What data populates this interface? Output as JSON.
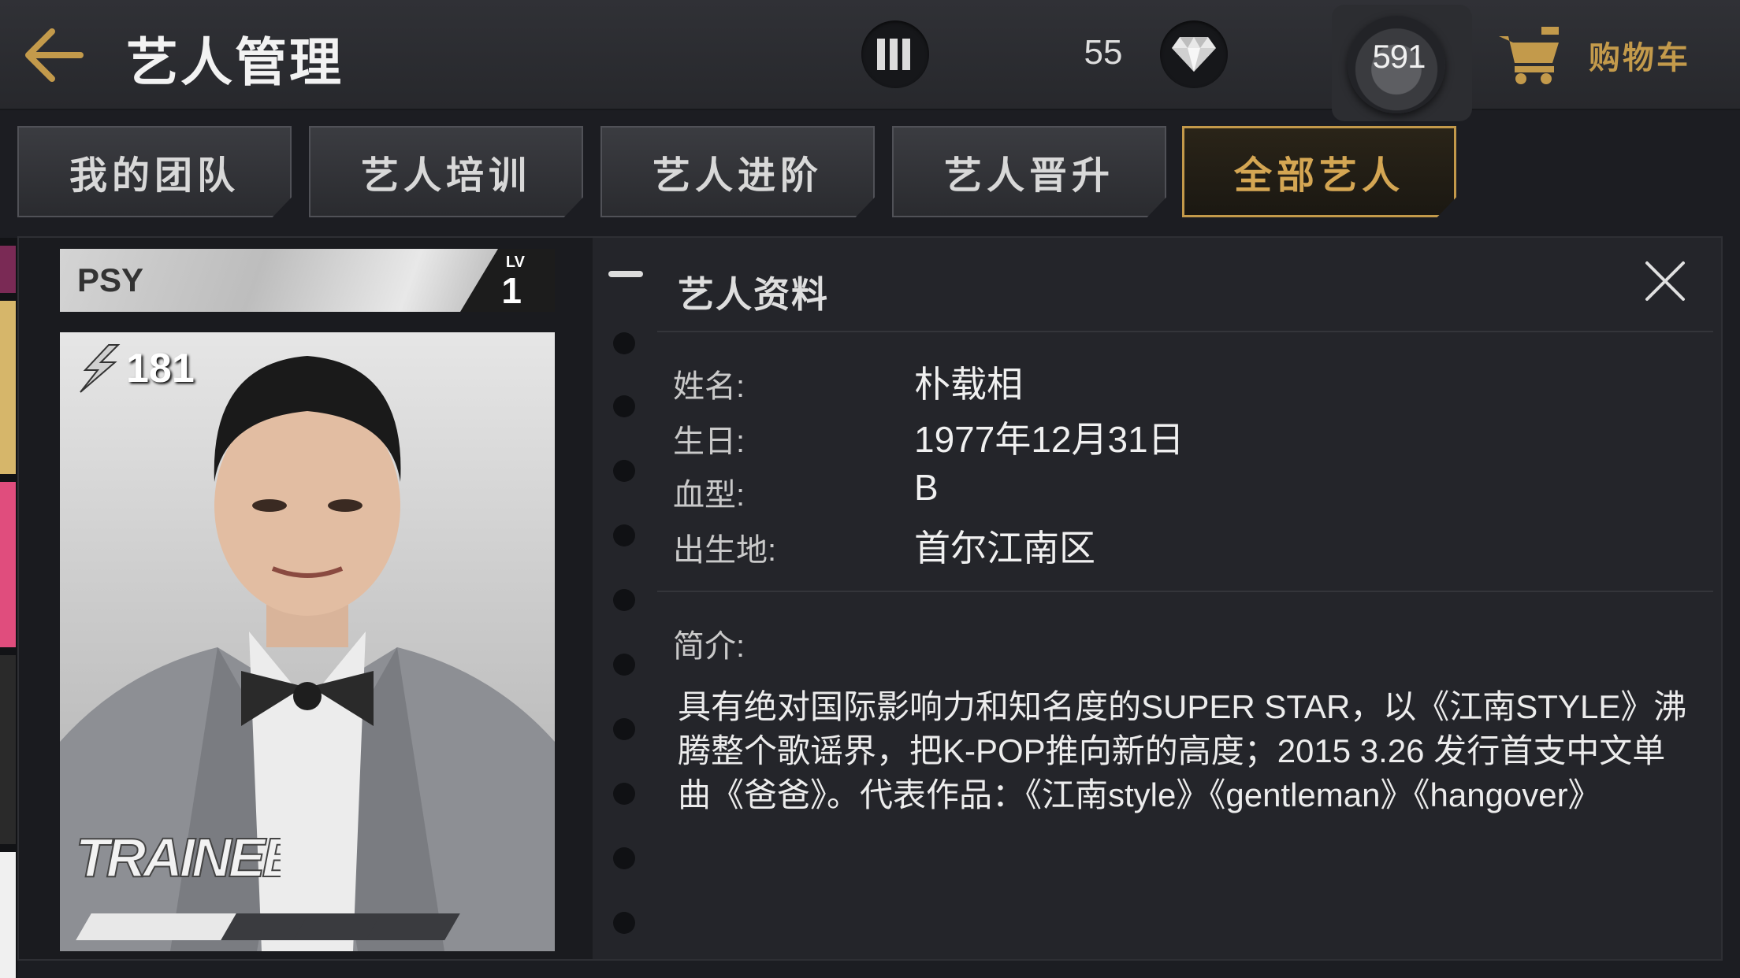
{
  "header": {
    "title": "艺人管理",
    "action_points": "55",
    "coins": "591",
    "cart_label": "购物车"
  },
  "tabs": [
    {
      "label": "我的团队",
      "active": false
    },
    {
      "label": "艺人培训",
      "active": false
    },
    {
      "label": "艺人进阶",
      "active": false
    },
    {
      "label": "艺人晋升",
      "active": false
    },
    {
      "label": "全部艺人",
      "active": true
    }
  ],
  "card": {
    "name": "PSY",
    "lv_label": "LV",
    "level": "1",
    "power": "181",
    "rank_badge": "TRAINEE",
    "stars_filled": 2,
    "stars_total": 6
  },
  "info": {
    "title": "艺人资料",
    "fields": [
      {
        "label": "姓名:",
        "value": "朴载相"
      },
      {
        "label": "生日:",
        "value": "1977年12月31日"
      },
      {
        "label": "血型:",
        "value": "B"
      },
      {
        "label": "出生地:",
        "value": "首尔江南区"
      }
    ],
    "intro_label": "简介:",
    "intro_text": "具有绝对国际影响力和知名度的SUPER STAR，以《江南STYLE》沸腾整个歌谣界，把K-POP推向新的高度；2015 3.26 发行首支中文单曲《爸爸》。代表作品：《江南style》《gentleman》《hangover》"
  },
  "colors": {
    "accent_gold": "#c39a4b",
    "background": "#1c1d22"
  }
}
